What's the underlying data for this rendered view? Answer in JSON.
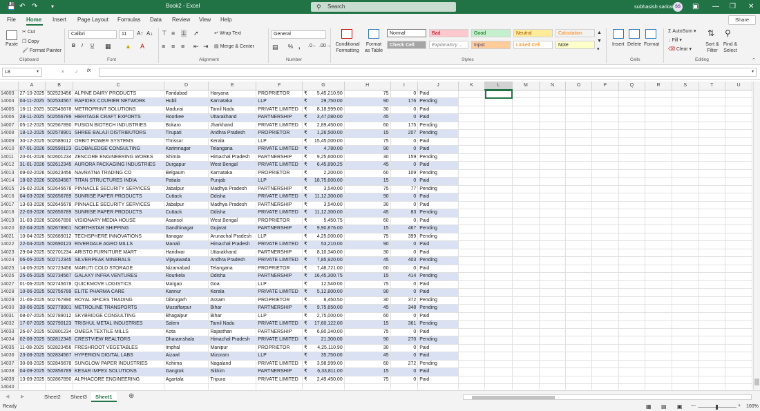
{
  "window": {
    "title": "Book2 - Excel",
    "search_placeholder": "Search",
    "user": "subhasish sarkar",
    "user_initials": "SS",
    "autosave": "AutoSave"
  },
  "menu": {
    "tabs": [
      "File",
      "Home",
      "Insert",
      "Page Layout",
      "Formulas",
      "Data",
      "Review",
      "View",
      "Help"
    ],
    "active": "Home",
    "share": "Share"
  },
  "ribbon": {
    "clipboard": {
      "paste": "Paste",
      "cut": "Cut",
      "copy": "Copy",
      "format_painter": "Format Painter",
      "label": "Clipboard"
    },
    "font": {
      "name": "Calibri",
      "size": "11",
      "label": "Font",
      "bold": "B",
      "italic": "I",
      "underline": "U"
    },
    "alignment": {
      "wrap_text": "Wrap Text",
      "merge": "Merge & Center",
      "label": "Alignment"
    },
    "number": {
      "format": "General",
      "label": "Number",
      "percent": "%",
      "comma": ","
    },
    "styles": {
      "conditional": "Conditional Formatting",
      "format_table": "Format as Table",
      "label": "Styles",
      "cells": [
        {
          "text": "Normal",
          "bg": "#ffffff",
          "fg": "#222222"
        },
        {
          "text": "Bad",
          "bg": "#ffc7ce",
          "fg": "#9c0006"
        },
        {
          "text": "Good",
          "bg": "#c6efce",
          "fg": "#006100"
        },
        {
          "text": "Neutral",
          "bg": "#ffeb9c",
          "fg": "#9c5700"
        },
        {
          "text": "Calculation",
          "bg": "#f2f2f2",
          "fg": "#fa7d00"
        },
        {
          "text": "Check Cell",
          "bg": "#a5a5a5",
          "fg": "#ffffff"
        },
        {
          "text": "Explanatory ...",
          "bg": "#ffffff",
          "fg": "#7f7f7f"
        },
        {
          "text": "Input",
          "bg": "#ffcc99",
          "fg": "#3f3f76"
        },
        {
          "text": "Linked Cell",
          "bg": "#ffffff",
          "fg": "#fa7d00"
        },
        {
          "text": "Note",
          "bg": "#ffffcc",
          "fg": "#222222"
        }
      ]
    },
    "cells": {
      "insert": "Insert",
      "delete": "Delete",
      "format": "Format",
      "label": "Cells"
    },
    "editing": {
      "autosum": "AutoSum",
      "fill": "Fill",
      "clear": "Clear",
      "sort": "Sort & Filter",
      "find": "Find & Select",
      "label": "Editing"
    }
  },
  "formula_bar": {
    "name_box": "L8",
    "fx": "fx",
    "content": ""
  },
  "columns": [
    "A",
    "B",
    "C",
    "D",
    "E",
    "F",
    "G",
    "H",
    "I",
    "J",
    "K",
    "L",
    "M",
    "N",
    "O",
    "P",
    "Q",
    "R",
    "S",
    "T",
    "U"
  ],
  "selected_column": "L",
  "currency_symbol": "₹",
  "rows": [
    [
      "14003",
      "27-10-2025",
      "502523456",
      "ALPINE DAIRY PRODUCTS",
      "Faridabad",
      "Haryana",
      "PROPRIETOR",
      "5,45,210.90",
      "75",
      "0",
      "Paid"
    ],
    [
      "14004",
      "04-11-2025",
      "502534567",
      "RAPIDEX COURIER NETWORK",
      "Hubli",
      "Karnataka",
      "LLP",
      "29,750.00",
      "90",
      "176",
      "Pending"
    ],
    [
      "14005",
      "16-11-2025",
      "502545678",
      "METROPRINT SOLUTIONS",
      "Madurai",
      "Tamil Nadu",
      "PRIVATE LIMITED",
      "8,18,999.00",
      "30",
      "0",
      "Paid"
    ],
    [
      "14006",
      "28-11-2025",
      "502556789",
      "HERITAGE CRAFT EXPORTS",
      "Roorkee",
      "Uttarakhand",
      "PARTNERSHIP",
      "3,47,080.00",
      "45",
      "0",
      "Paid"
    ],
    [
      "14007",
      "05-12-2025",
      "502567890",
      "FUSION BIOTECH INDUSTRIES",
      "Bokaro",
      "Jharkhand",
      "PRIVATE LIMITED",
      "2,89,450.00",
      "60",
      "175",
      "Pending"
    ],
    [
      "14008",
      "18-12-2025",
      "502578901",
      "SHREE BALAJI DISTRIBUTORS",
      "Tirupati",
      "Andhra Pradesh",
      "PROPRIETOR",
      "1,26,500.00",
      "15",
      "207",
      "Pending"
    ],
    [
      "14009",
      "30-12-2025",
      "502589012",
      "ORBIT POWER SYSTEMS",
      "Thrissur",
      "Kerala",
      "LLP",
      "15,45,000.00",
      "75",
      "0",
      "Paid"
    ],
    [
      "14010",
      "07-01-2026",
      "502590123",
      "GLOBALEDGE CONSULTING",
      "Karimnagar",
      "Telangana",
      "PRIVATE LIMITED",
      "4,780.00",
      "90",
      "0",
      "Paid"
    ],
    [
      "14011",
      "20-01-2026",
      "502601234",
      "ZENCORE ENGINEERING WORKS",
      "Shimla",
      "Himachal Pradesh",
      "PARTNERSHIP",
      "9,25,600.00",
      "30",
      "159",
      "Pending"
    ],
    [
      "14012",
      "31-01-2026",
      "502612345",
      "AURORA PACKAGING INDUSTRIES",
      "Durgapur",
      "West Bengal",
      "PRIVATE LIMITED",
      "6,45,890.25",
      "45",
      "0",
      "Paid"
    ],
    [
      "14013",
      "09-02-2026",
      "502623456",
      "NAVRATNA TRADING CO",
      "Belgaum",
      "Karnataka",
      "PROPRIETOR",
      "2,200.00",
      "60",
      "109",
      "Pending"
    ],
    [
      "14014",
      "18-02-2026",
      "502634567",
      "TITAN STRUCTURES INDIA",
      "Patiala",
      "Punjab",
      "LLP",
      "18,75,600.00",
      "15",
      "0",
      "Paid"
    ],
    [
      "14015",
      "26-02-2026",
      "502645678",
      "PINNACLE SECURITY SERVICES",
      "Jabalpur",
      "Madhya Pradesh",
      "PARTNERSHIP",
      "3,540.00",
      "75",
      "77",
      "Pending"
    ],
    [
      "14016",
      "04-03-2026",
      "502656789",
      "SUNRISE PAPER PRODUCTS",
      "Cuttack",
      "Odisha",
      "PRIVATE LIMITED",
      "11,12,300.00",
      "90",
      "0",
      "Paid"
    ],
    [
      "14017",
      "13-03-2026",
      "502645678",
      "PINNACLE SECURITY SERVICES",
      "Jabalpur",
      "Madhya Pradesh",
      "PARTNERSHIP",
      "3,540.00",
      "30",
      "0",
      "Paid"
    ],
    [
      "14018",
      "22-03-2026",
      "502656789",
      "SUNRISE PAPER PRODUCTS",
      "Cuttack",
      "Odisha",
      "PRIVATE LIMITED",
      "11,12,300.00",
      "45",
      "83",
      "Pending"
    ],
    [
      "14019",
      "31-03-2026",
      "502667890",
      "VISIONARY MEDIA HOUSE",
      "Asansol",
      "West Bengal",
      "PROPRIETOR",
      "5,450.75",
      "60",
      "0",
      "Paid"
    ],
    [
      "14020",
      "02-04-2025",
      "502678901",
      "NORTHSTAR SHIPPING",
      "Gandhinagar",
      "Gujarat",
      "PARTNERSHIP",
      "9,90,876.00",
      "15",
      "467",
      "Pending"
    ],
    [
      "14021",
      "10-04-2025",
      "502689012",
      "TECHSPHERE INNOVATIONS",
      "Itanagar",
      "Arunachal Pradesh",
      "LLP",
      "4,25,000.00",
      "75",
      "399",
      "Pending"
    ],
    [
      "14022",
      "22-04-2025",
      "502690123",
      "RIVERDALE AGRO MILLS",
      "Manali",
      "Himachal Pradesh",
      "PRIVATE LIMITED",
      "53,210.00",
      "90",
      "0",
      "Paid"
    ],
    [
      "14023",
      "29-04-2025",
      "502701234",
      "ARISTO FURNITURE MART",
      "Haridwar",
      "Uttarakhand",
      "PARTNERSHIP",
      "8,10,340.00",
      "30",
      "0",
      "Paid"
    ],
    [
      "14024",
      "06-05-2025",
      "502712345",
      "SILVERPEAK MINERALS",
      "Vijayawada",
      "Andhra Pradesh",
      "PRIVATE LIMITED",
      "7,85,920.00",
      "45",
      "403",
      "Pending"
    ],
    [
      "14025",
      "14-05-2025",
      "502723456",
      "MARUTI COLD STORAGE",
      "Nizamabad",
      "Telangana",
      "PROPRIETOR",
      "7,48,721.00",
      "60",
      "0",
      "Paid"
    ],
    [
      "14026",
      "25-05-2025",
      "502734567",
      "GALAXY INFRA VENTURES",
      "Rourkela",
      "Odisha",
      "PARTNERSHIP",
      "16,45,300.75",
      "15",
      "414",
      "Pending"
    ],
    [
      "14027",
      "01-06-2025",
      "502745678",
      "QUICKMOVE LOGISTICS",
      "Margao",
      "Goa",
      "LLP",
      "12,540.00",
      "75",
      "0",
      "Paid"
    ],
    [
      "14028",
      "10-06-2025",
      "502756789",
      "ELITE PHARMA CARE",
      "Kannur",
      "Kerala",
      "PRIVATE LIMITED",
      "5,12,800.00",
      "90",
      "0",
      "Paid"
    ],
    [
      "14029",
      "21-06-2025",
      "502767890",
      "ROYAL SPICES TRADING",
      "Dibrugarh",
      "Assam",
      "PROPRIETOR",
      "8,450.50",
      "30",
      "372",
      "Pending"
    ],
    [
      "14030",
      "30-06-2025",
      "502778901",
      "METROLINE TRANSPORTS",
      "Muzaffarpur",
      "Bihar",
      "PARTNERSHIP",
      "9,75,650.00",
      "45",
      "348",
      "Pending"
    ],
    [
      "14031",
      "08-07-2025",
      "502789012",
      "SKYBRIDGE CONSULTING",
      "Bhagalpur",
      "Bihar",
      "LLP",
      "2,75,000.00",
      "60",
      "0",
      "Paid"
    ],
    [
      "14032",
      "17-07-2025",
      "502790123",
      "TRISHUL METAL INDUSTRIES",
      "Salem",
      "Tamil Nadu",
      "PRIVATE LIMITED",
      "17,60,122.00",
      "15",
      "361",
      "Pending"
    ],
    [
      "14033",
      "26-07-2025",
      "502801234",
      "OMEGA TEXTILE MILLS",
      "Kota",
      "Rajasthan",
      "PARTNERSHIP",
      "6,80,340.00",
      "75",
      "0",
      "Paid"
    ],
    [
      "14034",
      "02-08-2025",
      "502812345",
      "CRESTVIEW REALTORS",
      "Dharamshala",
      "Himachal Pradesh",
      "PRIVATE LIMITED",
      "21,300.00",
      "90",
      "270",
      "Pending"
    ],
    [
      "14035",
      "11-08-2025",
      "502823456",
      "FRESHROOT VEGETABLES",
      "Imphal",
      "Manipur",
      "PROPRIETOR",
      "4,25,110.90",
      "30",
      "0",
      "Paid"
    ],
    [
      "14036",
      "23-08-2025",
      "502834567",
      "HYPERION DIGITAL LABS",
      "Aizawl",
      "Mizoram",
      "LLP",
      "35,750.00",
      "45",
      "0",
      "Paid"
    ],
    [
      "14037",
      "30-08-2025",
      "502845678",
      "SUNGLOW PAPER INDUSTRIES",
      "Kohima",
      "Nagaland",
      "PRIVATE LIMITED",
      "3,98,999.00",
      "60",
      "272",
      "Pending"
    ],
    [
      "14038",
      "04-09-2025",
      "502856789",
      "KESAR IMPEX SOLUTIONS",
      "Gangtok",
      "Sikkim",
      "PARTNERSHIP",
      "6,33,811.00",
      "15",
      "0",
      "Paid"
    ],
    [
      "14039",
      "13-09-2025",
      "502867890",
      "ALPHACORE ENGINEERING",
      "Agartala",
      "Tripura",
      "PRIVATE LIMITED",
      "2,49,450.00",
      "75",
      "0",
      "Paid"
    ],
    [
      "14040",
      "",
      "",
      "",
      "",
      "",
      "",
      "",
      "",
      "",
      ""
    ]
  ],
  "sheets": [
    "Sheet2",
    "Sheet3",
    "Sheet1"
  ],
  "active_sheet": "Sheet1",
  "status": {
    "ready": "Ready",
    "zoom": "100%"
  }
}
